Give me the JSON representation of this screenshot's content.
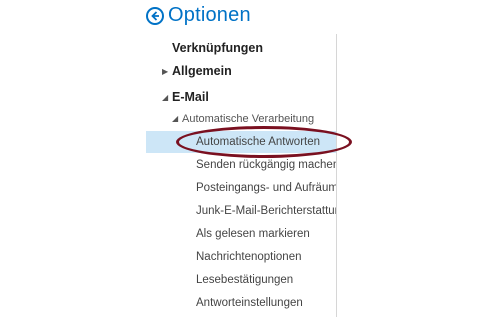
{
  "header": {
    "title": "Optionen",
    "back_icon": "back-circle-arrow-icon"
  },
  "nav": {
    "shortcuts": "Verknüpfungen",
    "general": "Allgemein",
    "email": "E-Mail",
    "auto_processing": "Automatische Verarbeitung",
    "items": [
      "Automatische Antworten",
      "Senden rückgängig machen",
      "Posteingangs- und Aufräumregeln",
      "Junk-E-Mail-Berichterstattung",
      "Als gelesen markieren",
      "Nachrichtenoptionen",
      "Lesebestätigungen",
      "Antworteinstellungen"
    ]
  },
  "colors": {
    "accent": "#0072c6",
    "selected_bg": "#cde6f7",
    "highlight_oval": "#7a1020"
  }
}
